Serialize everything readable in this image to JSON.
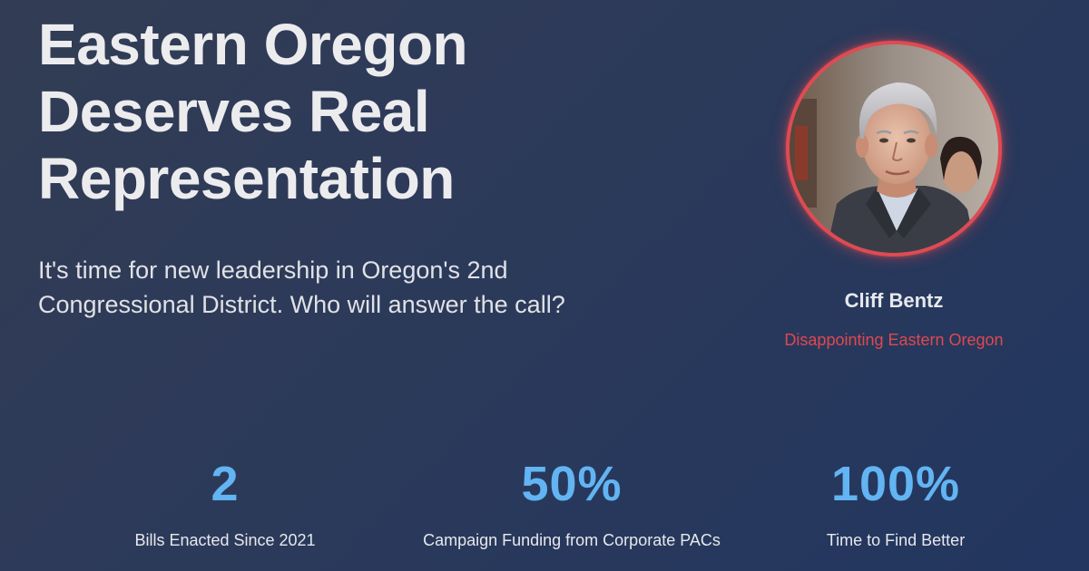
{
  "hero": {
    "headline_lines": [
      "Eastern Oregon",
      "Deserves Real",
      "Representation"
    ],
    "subhead_lines": [
      "It's time for new leadership in Oregon's 2nd",
      "Congressional District. Who will answer the call?"
    ]
  },
  "profile": {
    "name": "Cliff Bentz",
    "tagline": "Disappointing Eastern Oregon",
    "ring_color": "#e04a52"
  },
  "stats": [
    {
      "value": "2",
      "label": "Bills Enacted Since 2021"
    },
    {
      "value": "50%",
      "label": "Campaign Funding from Corporate PACs"
    },
    {
      "value": "100%",
      "label": "Time to Find Better"
    }
  ],
  "colors": {
    "accent_blue": "#62b4f2",
    "accent_red": "#e0484f"
  }
}
